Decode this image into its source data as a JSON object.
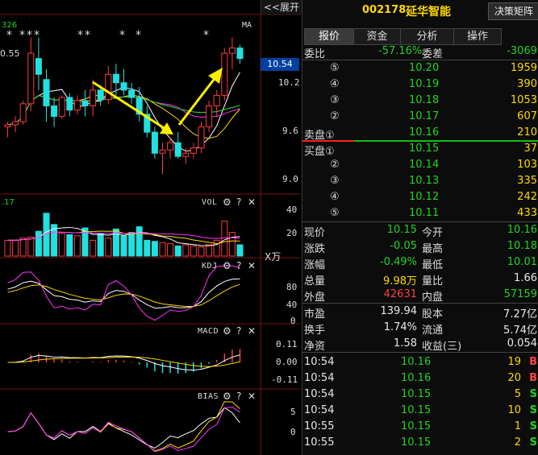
{
  "chart": {
    "expand_label": "<<展开",
    "ma_label": "MA",
    "stars": [
      "*",
      "***",
      "**",
      "*",
      "*",
      "*"
    ],
    "price_high_marker": "0.55",
    "ma_value_fragment": "326",
    "current_price_tag": "10.54",
    "price_axis": [
      "10.2",
      "9.6",
      "9.0"
    ],
    "vol": {
      "title": "VOL",
      "value_fragment": ".17",
      "axis": [
        "40",
        "20"
      ],
      "unit": "X万"
    },
    "kdj": {
      "title": "KDJ",
      "axis": [
        "80",
        "40",
        "0"
      ]
    },
    "macd": {
      "title": "MACD",
      "axis": [
        "0.11",
        "0.00",
        "-0.11"
      ]
    },
    "bias": {
      "title": "BIAS",
      "axis": [
        "5",
        "0"
      ]
    },
    "icons": {
      "gear": "⚙",
      "help": "?",
      "close": "✕"
    }
  },
  "chart_data": {
    "type": "candlestick",
    "title": "",
    "ylim": [
      8.9,
      10.4
    ],
    "candles": [
      {
        "o": 9.5,
        "h": 9.55,
        "l": 9.4,
        "c": 9.52
      },
      {
        "o": 9.52,
        "h": 9.6,
        "l": 9.45,
        "c": 9.55
      },
      {
        "o": 9.55,
        "h": 9.75,
        "l": 9.52,
        "c": 9.72
      },
      {
        "o": 9.72,
        "h": 10.35,
        "l": 9.65,
        "c": 10.2
      },
      {
        "o": 10.15,
        "h": 10.35,
        "l": 9.85,
        "c": 10.0
      },
      {
        "o": 9.95,
        "h": 10.05,
        "l": 9.55,
        "c": 9.7
      },
      {
        "o": 9.7,
        "h": 9.78,
        "l": 9.5,
        "c": 9.6
      },
      {
        "o": 9.6,
        "h": 9.8,
        "l": 9.58,
        "c": 9.78
      },
      {
        "o": 9.78,
        "h": 9.82,
        "l": 9.6,
        "c": 9.66
      },
      {
        "o": 9.66,
        "h": 9.8,
        "l": 9.62,
        "c": 9.75
      },
      {
        "o": 9.75,
        "h": 9.85,
        "l": 9.6,
        "c": 9.7
      },
      {
        "o": 9.7,
        "h": 9.95,
        "l": 9.6,
        "c": 9.85
      },
      {
        "o": 9.85,
        "h": 9.9,
        "l": 9.7,
        "c": 9.76
      },
      {
        "o": 9.76,
        "h": 10.08,
        "l": 9.72,
        "c": 10.0
      },
      {
        "o": 10.0,
        "h": 10.1,
        "l": 9.8,
        "c": 9.92
      },
      {
        "o": 9.92,
        "h": 10.05,
        "l": 9.8,
        "c": 9.85
      },
      {
        "o": 9.85,
        "h": 9.92,
        "l": 9.72,
        "c": 9.78
      },
      {
        "o": 9.78,
        "h": 9.88,
        "l": 9.55,
        "c": 9.62
      },
      {
        "o": 9.62,
        "h": 9.7,
        "l": 9.4,
        "c": 9.45
      },
      {
        "o": 9.45,
        "h": 9.5,
        "l": 9.2,
        "c": 9.25
      },
      {
        "o": 9.25,
        "h": 9.35,
        "l": 9.05,
        "c": 9.28
      },
      {
        "o": 9.28,
        "h": 9.4,
        "l": 9.2,
        "c": 9.35
      },
      {
        "o": 9.35,
        "h": 9.45,
        "l": 9.2,
        "c": 9.22
      },
      {
        "o": 9.22,
        "h": 9.3,
        "l": 9.15,
        "c": 9.25
      },
      {
        "o": 9.25,
        "h": 9.35,
        "l": 9.2,
        "c": 9.3
      },
      {
        "o": 9.3,
        "h": 9.55,
        "l": 9.25,
        "c": 9.5
      },
      {
        "o": 9.5,
        "h": 9.75,
        "l": 9.45,
        "c": 9.7
      },
      {
        "o": 9.7,
        "h": 9.85,
        "l": 9.6,
        "c": 9.8
      },
      {
        "o": 9.8,
        "h": 10.25,
        "l": 9.75,
        "c": 10.2
      },
      {
        "o": 10.2,
        "h": 10.35,
        "l": 10.05,
        "c": 10.25
      },
      {
        "o": 10.25,
        "h": 10.28,
        "l": 10.1,
        "c": 10.15
      }
    ],
    "volume": [
      14,
      14,
      16,
      17,
      22,
      38,
      28,
      20,
      19,
      18,
      25,
      14,
      20,
      16,
      24,
      18,
      21,
      26,
      14,
      13,
      12,
      11,
      9,
      10,
      9,
      8,
      10,
      14,
      31,
      21,
      10
    ]
  },
  "quote": {
    "code": "002178",
    "name": "延华智能",
    "decision_btn": "决策矩阵",
    "tabs": [
      "报价",
      "资金",
      "分析",
      "操作"
    ],
    "weibi": {
      "label": "委比",
      "value": "-57.16%",
      "diff_label": "委差",
      "diff_value": "-3069"
    },
    "sells": [
      {
        "label": "⑤",
        "price": "10.20",
        "vol": "1959"
      },
      {
        "label": "④",
        "price": "10.19",
        "vol": "390"
      },
      {
        "label": "③",
        "price": "10.18",
        "vol": "1053"
      },
      {
        "label": "②",
        "price": "10.17",
        "vol": "607"
      },
      {
        "label": "卖盘①",
        "price": "10.16",
        "vol": "210"
      }
    ],
    "buys": [
      {
        "label": "买盘①",
        "price": "10.15",
        "vol": "37"
      },
      {
        "label": "②",
        "price": "10.14",
        "vol": "103"
      },
      {
        "label": "③",
        "price": "10.13",
        "vol": "335"
      },
      {
        "label": "④",
        "price": "10.12",
        "vol": "242"
      },
      {
        "label": "⑤",
        "price": "10.11",
        "vol": "433"
      }
    ],
    "stats": [
      {
        "l1": "现价",
        "v1": "10.15",
        "c1": "green",
        "l2": "今开",
        "v2": "10.16",
        "c2": "green"
      },
      {
        "l1": "涨跌",
        "v1": "-0.05",
        "c1": "green",
        "l2": "最高",
        "v2": "10.18",
        "c2": "green"
      },
      {
        "l1": "涨幅",
        "v1": "-0.49%",
        "c1": "green",
        "l2": "最低",
        "v2": "10.01",
        "c2": "green"
      },
      {
        "l1": "总量",
        "v1": "9.98万",
        "c1": "yellow",
        "l2": "量比",
        "v2": "1.66",
        "c2": "white"
      },
      {
        "l1": "外盘",
        "v1": "42631",
        "c1": "red",
        "l2": "内盘",
        "v2": "57159",
        "c2": "green"
      }
    ],
    "fund": [
      {
        "l1": "市盈",
        "v1": "139.94",
        "l2": "股本",
        "v2": "7.27亿"
      },
      {
        "l1": "换手",
        "v1": "1.74%",
        "l2": "流通",
        "v2": "5.74亿"
      },
      {
        "l1": "净资",
        "v1": "1.58",
        "l2": "收益(三)",
        "v2": "0.054"
      }
    ],
    "ticks": [
      {
        "time": "10:54",
        "price": "10.16",
        "vol": "19",
        "side": "B",
        "side_color": "red"
      },
      {
        "time": "10:54",
        "price": "10.16",
        "vol": "20",
        "side": "B",
        "side_color": "red"
      },
      {
        "time": "10:54",
        "price": "10.15",
        "vol": "5",
        "side": "S",
        "side_color": "green"
      },
      {
        "time": "10:54",
        "price": "10.15",
        "vol": "10",
        "side": "S",
        "side_color": "green"
      },
      {
        "time": "10:55",
        "price": "10.15",
        "vol": "1",
        "side": "S",
        "side_color": "green"
      },
      {
        "time": "10:55",
        "price": "10.15",
        "vol": "2",
        "side": "S",
        "side_color": "green"
      }
    ]
  },
  "colors": {
    "up": "#ff3b3b",
    "down": "#21e0e0",
    "ma5": "#ffffff",
    "ma10": "#ffd800",
    "ma20": "#ff33ff",
    "ma30": "#33dd33",
    "arrow": "#ffee00"
  }
}
